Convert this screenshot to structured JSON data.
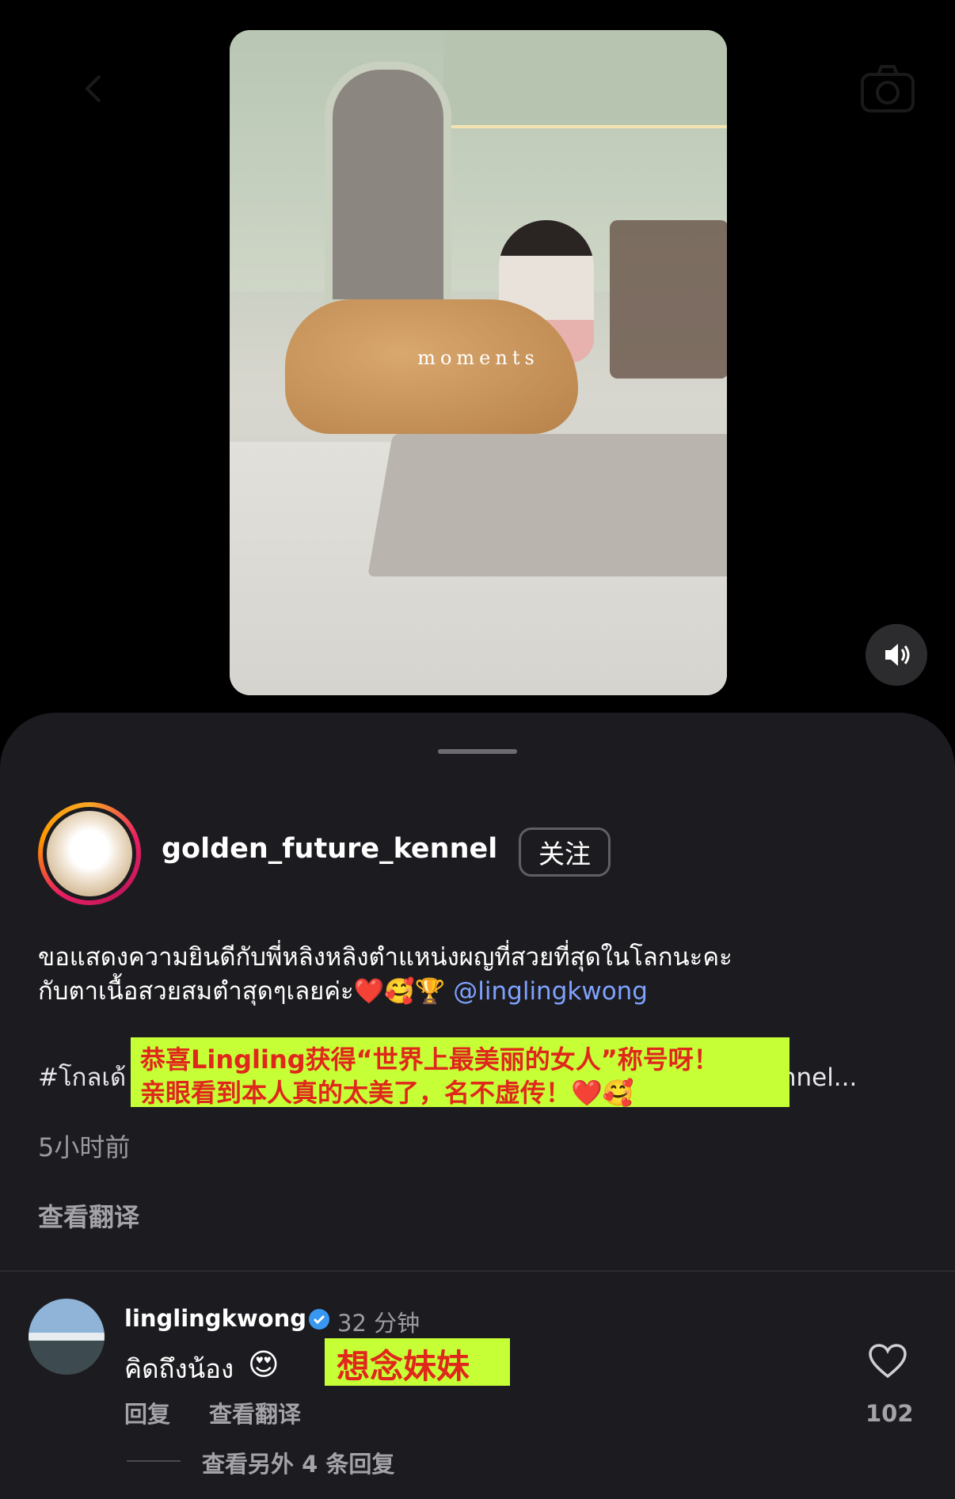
{
  "video": {
    "overlay_text": "moments"
  },
  "post": {
    "username": "golden_future_kennel",
    "follow_label": "关注",
    "caption_line1": "ขอแสดงความยินดีกับพี่หลิงหลิงตำแหน่งผญที่สวยที่สุดในโลกนะคะ",
    "caption_line2": "กับตาเนื้อสวยสมตำสุดๆเลยค่ะ❤️🥰🏆",
    "mention": "@linglingkwong",
    "caption_line3_start": "#โกลเด้",
    "caption_line3_end": "urekennel...",
    "translation_overlay_line1": "恭喜Lingling获得“世界上最美丽的女人”称号呀！",
    "translation_overlay_line2": "亲眼看到本人真的太美了，名不虚传！❤️🥰",
    "time_ago": "5小时前",
    "see_translation": "查看翻译"
  },
  "comment": {
    "username": "linglingkwong",
    "time": "32 分钟",
    "text": "คิดถึงน้อง",
    "emoji": "😍",
    "translation_overlay": "想念妹妹",
    "reply_label": "回复",
    "translate_label": "查看翻译",
    "like_count": "102",
    "more_replies": "查看另外 4 条回复"
  },
  "icons": {
    "back": "chevron-left-icon",
    "camera": "camera-icon",
    "volume": "speaker-icon",
    "verified": "verified-badge-icon",
    "like": "heart-icon"
  },
  "colors": {
    "sheet": "#1c1c20",
    "mention": "#7fa2ff",
    "highlight": "#c6ff36",
    "highlight_text": "#e0271c"
  }
}
